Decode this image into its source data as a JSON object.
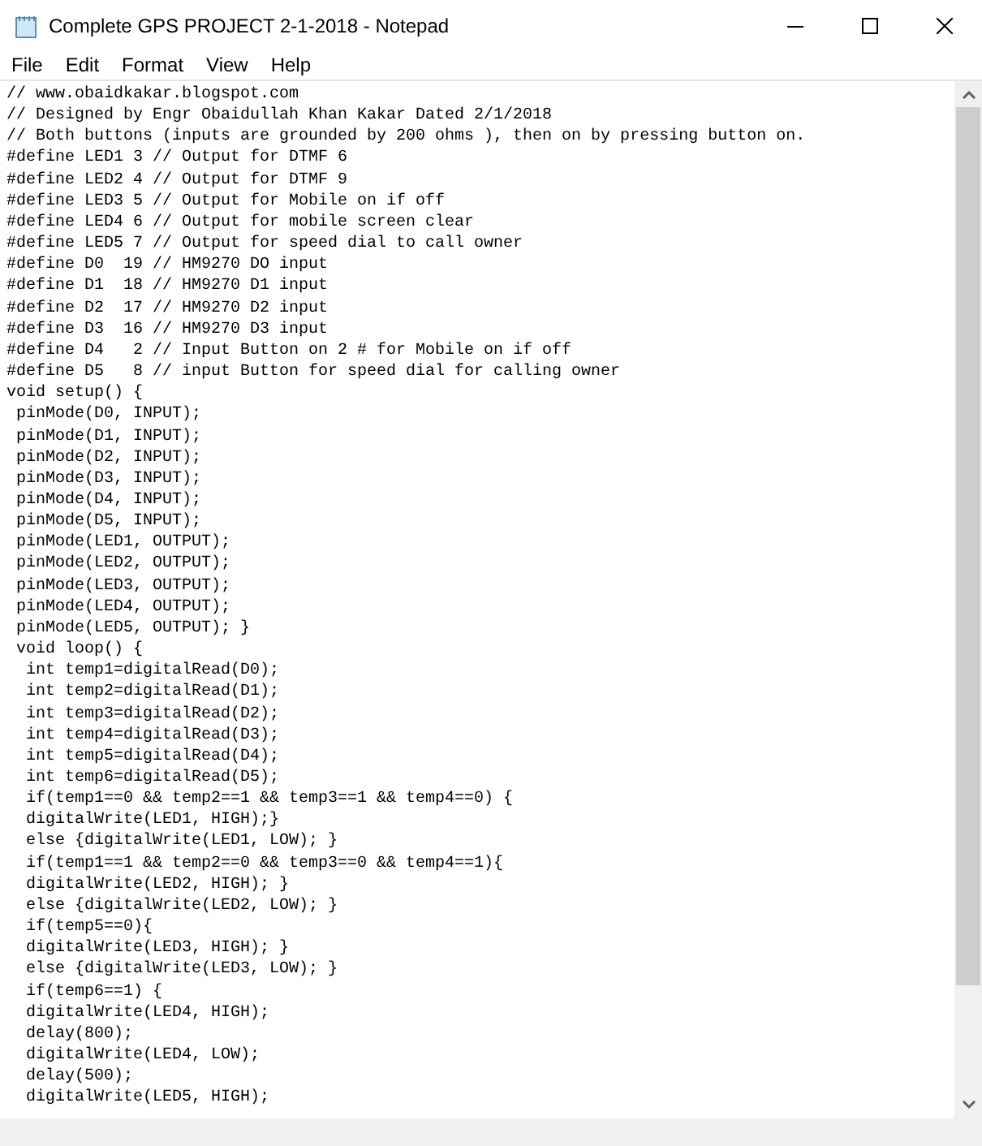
{
  "window": {
    "title": "Complete GPS PROJECT 2-1-2018 - Notepad"
  },
  "menu": [
    "File",
    "Edit",
    "Format",
    "View",
    "Help"
  ],
  "lines": [
    "// www.obaidkakar.blogspot.com",
    "// Designed by Engr Obaidullah Khan Kakar Dated 2/1/2018",
    "// Both buttons (inputs are grounded by 200 ohms ), then on by pressing button on.",
    "#define LED1 3 // Output for DTMF 6",
    "#define LED2 4 // Output for DTMF 9",
    "#define LED3 5 // Output for Mobile on if off",
    "#define LED4 6 // Output for mobile screen clear",
    "#define LED5 7 // Output for speed dial to call owner",
    "#define D0  19 // HM9270 DO input",
    "#define D1  18 // HM9270 D1 input",
    "#define D2  17 // HM9270 D2 input",
    "#define D3  16 // HM9270 D3 input",
    "#define D4   2 // Input Button on 2 # for Mobile on if off",
    "#define D5   8 // input Button for speed dial for calling owner",
    "void setup() {",
    " pinMode(D0, INPUT);",
    " pinMode(D1, INPUT);",
    " pinMode(D2, INPUT);",
    " pinMode(D3, INPUT);",
    " pinMode(D4, INPUT);",
    " pinMode(D5, INPUT);",
    " pinMode(LED1, OUTPUT);",
    " pinMode(LED2, OUTPUT);",
    " pinMode(LED3, OUTPUT);",
    " pinMode(LED4, OUTPUT);",
    " pinMode(LED5, OUTPUT); }",
    " void loop() {",
    "  int temp1=digitalRead(D0);",
    "  int temp2=digitalRead(D1);",
    "  int temp3=digitalRead(D2);",
    "  int temp4=digitalRead(D3);",
    "  int temp5=digitalRead(D4);",
    "  int temp6=digitalRead(D5);",
    "  if(temp1==0 && temp2==1 && temp3==1 && temp4==0) {",
    "  digitalWrite(LED1, HIGH);}",
    "  else {digitalWrite(LED1, LOW); }",
    "  if(temp1==1 && temp2==0 && temp3==0 && temp4==1){",
    "  digitalWrite(LED2, HIGH); }",
    "  else {digitalWrite(LED2, LOW); }",
    "  if(temp5==0){",
    "  digitalWrite(LED3, HIGH); }",
    "  else {digitalWrite(LED3, LOW); }",
    "  if(temp6==1) {",
    "  digitalWrite(LED4, HIGH);",
    "  delay(800);",
    "  digitalWrite(LED4, LOW);",
    "  delay(500);",
    "  digitalWrite(LED5, HIGH);"
  ]
}
